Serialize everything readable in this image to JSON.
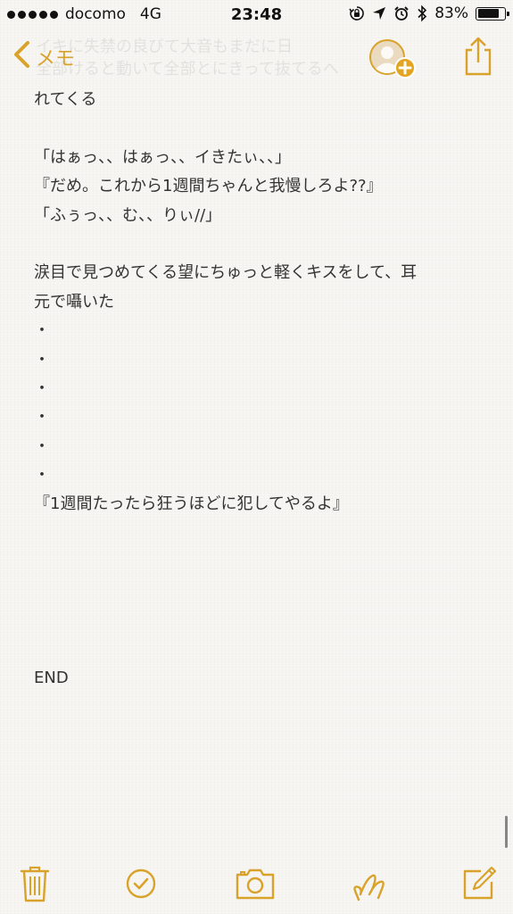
{
  "status_bar": {
    "carrier": "docomo",
    "network": "4G",
    "time": "23:48",
    "battery_percent": "83%",
    "battery_level": 0.83,
    "icons": [
      "orientation-lock-icon",
      "location-arrow-icon",
      "alarm-clock-icon",
      "bluetooth-icon",
      "battery-icon"
    ]
  },
  "nav": {
    "back_label": "メモ",
    "back_icon": "chevron-left-icon",
    "avatar_icon": "add-people-icon",
    "share_icon": "share-icon",
    "ghost_lines": [
      "イキに失禁の良びて大音もまだに日",
      "全部けると動いて全部とにきって抜てるへ",
      "れてくる"
    ]
  },
  "note": {
    "lines": [
      "れてくる",
      "",
      "「はぁっ、、はぁっ、、イきたぃ、、」",
      "『だめ。これから1週間ちゃんと我慢しろよ??』",
      "「ふぅっ、、む、、りぃ//」",
      "",
      "涙目で見つめてくる望にちゅっと軽くキスをして、耳",
      "元で囁いた",
      "・",
      "・",
      "・",
      "・",
      "・",
      "・",
      "『1週間たったら狂うほどに犯してやるよ』",
      "",
      "",
      "",
      "",
      "",
      "END"
    ]
  },
  "toolbar": {
    "items": [
      "trash-icon",
      "checklist-icon",
      "camera-icon",
      "sketch-icon",
      "compose-icon"
    ]
  },
  "colors": {
    "accent": "#d9a22a",
    "text": "#333333",
    "paper": "#f7f6f3"
  }
}
